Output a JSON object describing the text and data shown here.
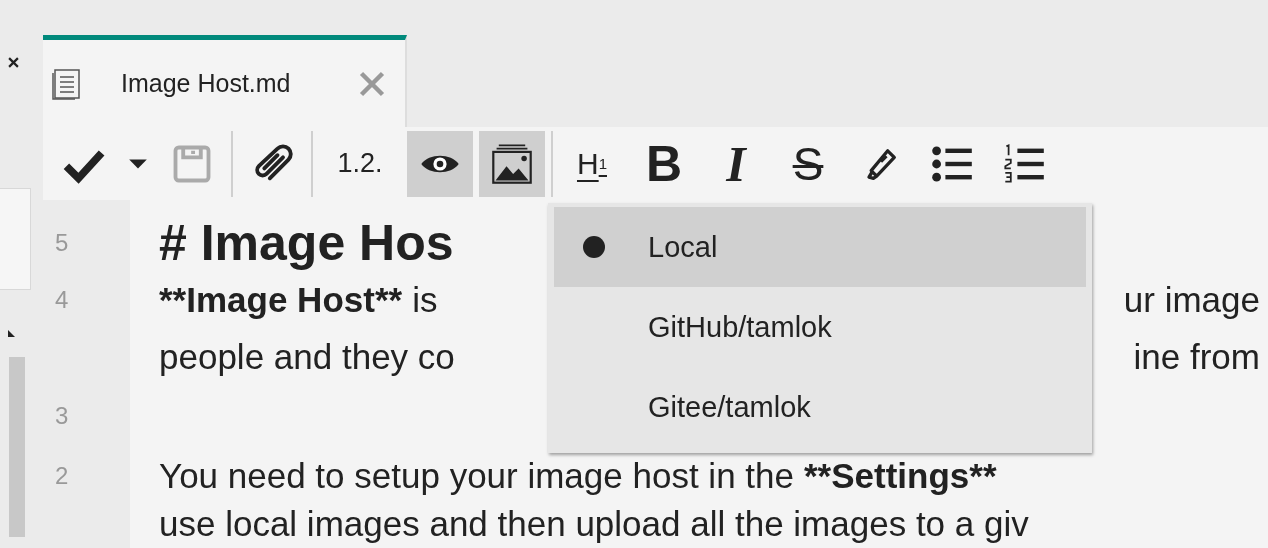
{
  "tab": {
    "title": "Image Host.md",
    "selected": true
  },
  "toolbar": {
    "save_disabled": true,
    "number_label": "1.2.",
    "preview_on": true,
    "image_host_on": true,
    "heading_label": "H",
    "heading_sub": "1",
    "bold_label": "B",
    "italic_label": "I",
    "strike_label": "S"
  },
  "editor_lines": [
    {
      "number": "5",
      "kind": "heading",
      "segments": [
        {
          "text": "# Image Hos",
          "bold": true
        }
      ]
    },
    {
      "number": "4",
      "kind": "text",
      "segments": [
        {
          "text": "**Image Host**",
          "bold": true
        },
        {
          "text": "is",
          "bold": false
        }
      ],
      "right": "ur image"
    },
    {
      "kind": "text",
      "segments": [
        {
          "text": "people and they co",
          "bold": false
        }
      ],
      "right": "ine from"
    },
    {
      "number": "3",
      "kind": "blank"
    },
    {
      "number": "2",
      "kind": "text",
      "segments": [
        {
          "text": "You need to setup your image host in the",
          "bold": false
        },
        {
          "text": "**Settings**",
          "bold": true
        }
      ]
    },
    {
      "kind": "text",
      "segments": [
        {
          "text": "use local images and then upload all the images to a giv",
          "bold": false
        }
      ]
    }
  ],
  "image_host_menu": [
    {
      "label": "Local",
      "selected": true
    },
    {
      "label": "GitHub/tamlok",
      "selected": false
    },
    {
      "label": "Gitee/tamlok",
      "selected": false
    }
  ]
}
